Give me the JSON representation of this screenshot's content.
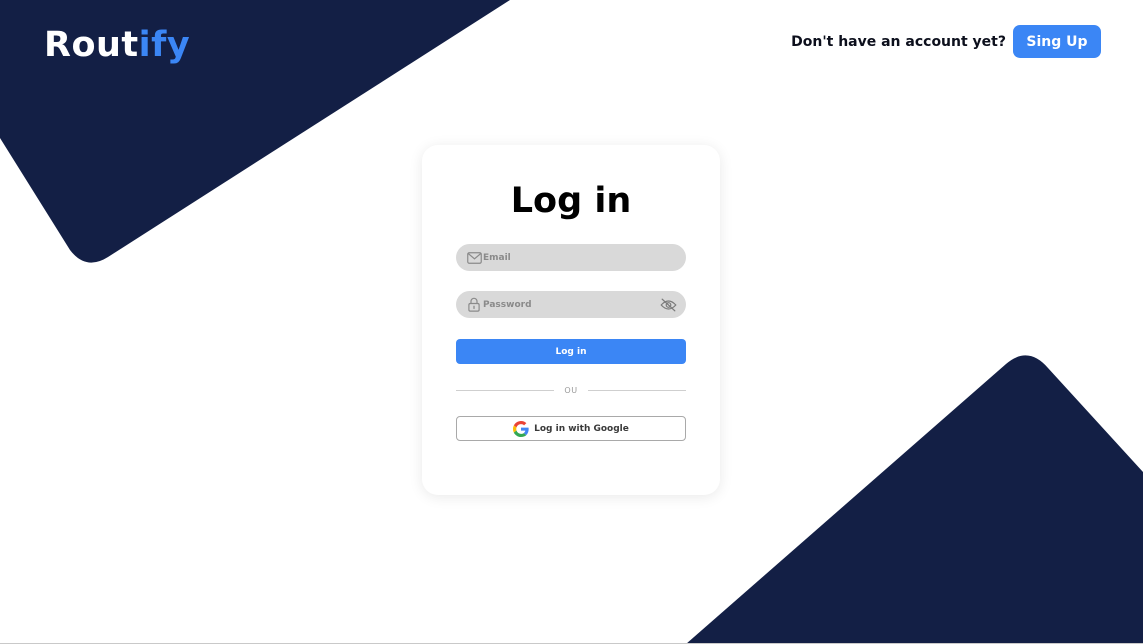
{
  "brand": {
    "name_prefix": "Rout",
    "name_accent": "ify",
    "accent_color": "#3b86f5"
  },
  "header": {
    "signup_prompt": "Don't have an account yet?",
    "signup_label": "Sing Up"
  },
  "login_form": {
    "title": "Log in",
    "email_placeholder": "Email",
    "password_placeholder": "Password",
    "login_label": "Log in",
    "divider_text": "OU",
    "google_label": "Log in with Google"
  },
  "icons": {
    "email": "envelope-icon",
    "password": "lock-icon",
    "toggle_password": "eye-off-icon",
    "google": "google-icon"
  },
  "colors": {
    "navy": "#131f45",
    "primary": "#3b86f5",
    "field_bg": "#d9d9d9",
    "background": "#ffffff"
  }
}
